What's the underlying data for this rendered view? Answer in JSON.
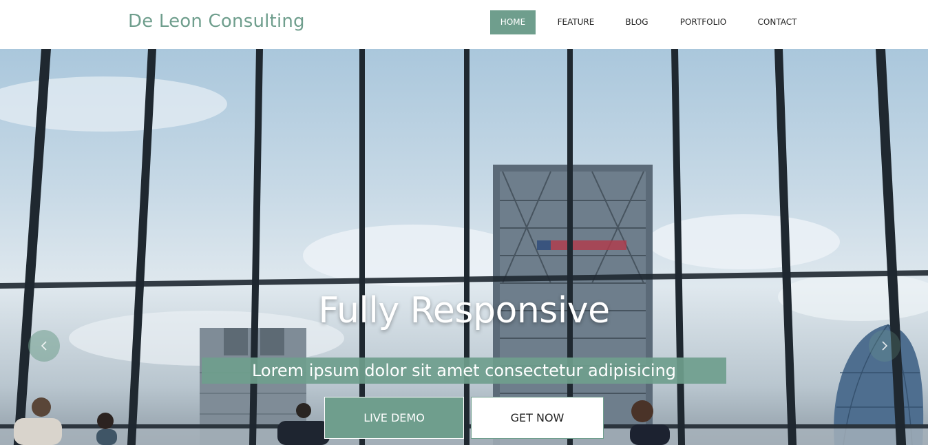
{
  "brand": {
    "name": "De Leon Consulting"
  },
  "nav": {
    "items": [
      {
        "label": "HOME",
        "active": true
      },
      {
        "label": "FEATURE",
        "active": false
      },
      {
        "label": "BLOG",
        "active": false
      },
      {
        "label": "PORTFOLIO",
        "active": false
      },
      {
        "label": "CONTACT",
        "active": false
      }
    ]
  },
  "hero": {
    "title": "Fully Responsive",
    "subtitle": "Lorem ipsum dolor sit amet consectetur adipisicing",
    "primary_button": "LIVE DEMO",
    "secondary_button": "GET NOW",
    "prev_icon": "chevron-left-icon",
    "next_icon": "chevron-right-icon"
  },
  "colors": {
    "accent": "#6f9e8d",
    "header_bg": "#ffffff",
    "nav_text": "#222222"
  }
}
